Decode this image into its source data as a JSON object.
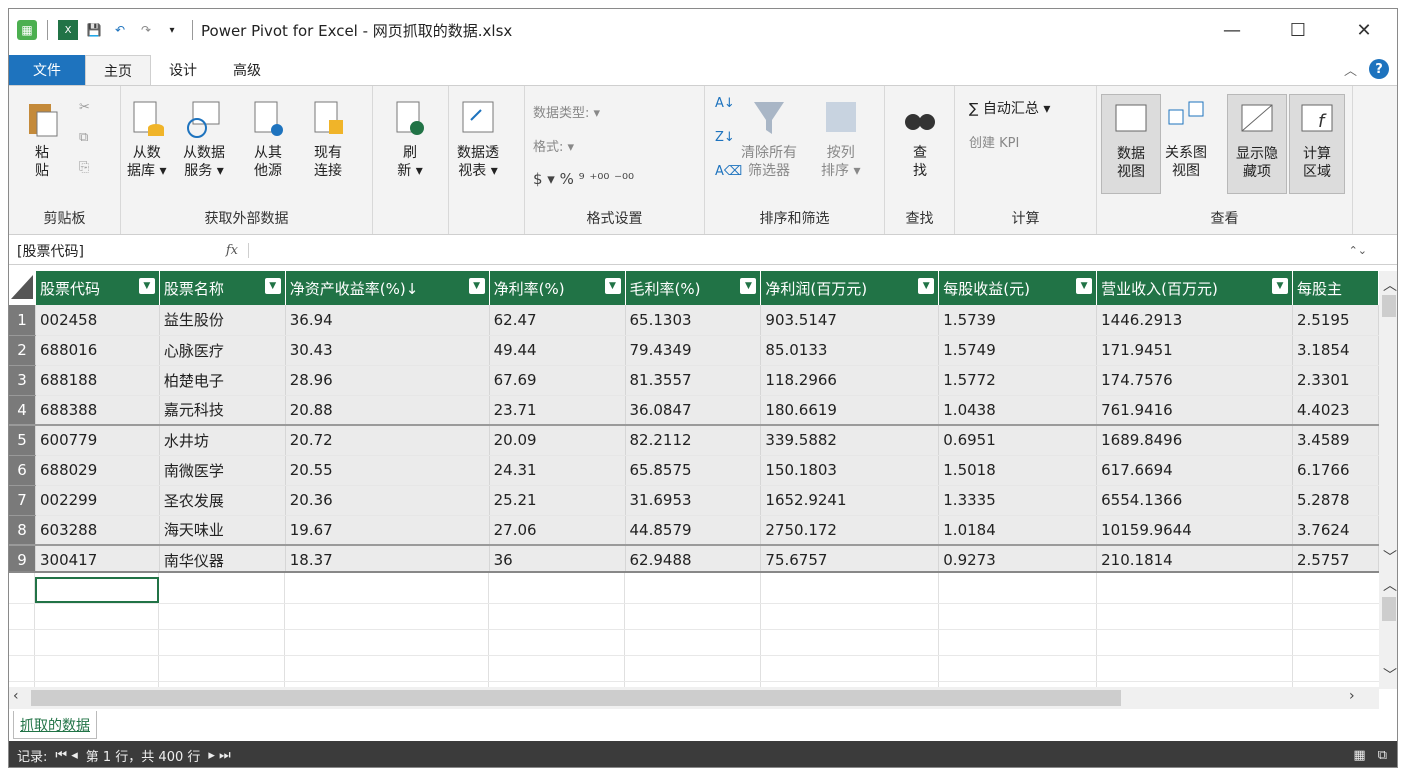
{
  "window": {
    "title": "Power Pivot for Excel - 网页抓取的数据.xlsx"
  },
  "window_controls": {
    "minimize": "—",
    "maximize": "☐",
    "close": "✕"
  },
  "tabs": [
    {
      "label": "文件"
    },
    {
      "label": "主页"
    },
    {
      "label": "设计"
    },
    {
      "label": "高级"
    }
  ],
  "ribbon": {
    "paste": "粘\n贴",
    "groups": {
      "clipboard": "剪贴板",
      "external": "获取外部数据",
      "format": "格式设置",
      "sort": "排序和筛选",
      "find": "查找",
      "calc": "计算",
      "view": "查看"
    },
    "from_db": "从数\n据库 ▾",
    "from_service": "从数据\n服务 ▾",
    "from_other": "从其\n他源",
    "existing": "现有\n连接",
    "refresh": "刷\n新 ▾",
    "pivot": "数据透\n视表 ▾",
    "datatype": "数据类型: ▾",
    "format": "格式: ▾",
    "currency_row": "$ ▾ % ⁹ ⁺⁰⁰ ⁻⁰⁰",
    "clear_filters": "清除所有\n筛选器",
    "sort_by_col": "按列\n排序 ▾",
    "find": "查\n找",
    "autosum": "∑ 自动汇总 ▾",
    "kpi": "创建 KPI",
    "data_view": "数据\n视图",
    "diagram_view": "关系图\n视图",
    "show_hidden": "显示隐\n藏项",
    "calc_area": "计算\n区域"
  },
  "formula_bar": {
    "name_box": "[股票代码]",
    "fx": "fx"
  },
  "table": {
    "columns": [
      "股票代码",
      "股票名称",
      "净资产收益率(%)↓",
      "净利率(%)",
      "毛利率(%)",
      "净利润(百万元)",
      "每股收益(元)",
      "营业收入(百万元)",
      "每股主"
    ],
    "rows": [
      [
        "1",
        "002458",
        "益生股份",
        "36.94",
        "62.47",
        "65.1303",
        "903.5147",
        "1.5739",
        "1446.2913",
        "2.5195"
      ],
      [
        "2",
        "688016",
        "心脉医疗",
        "30.43",
        "49.44",
        "79.4349",
        "85.0133",
        "1.5749",
        "171.9451",
        "3.1854"
      ],
      [
        "3",
        "688188",
        "柏楚电子",
        "28.96",
        "67.69",
        "81.3557",
        "118.2966",
        "1.5772",
        "174.7576",
        "2.3301"
      ],
      [
        "4",
        "688388",
        "嘉元科技",
        "20.88",
        "23.71",
        "36.0847",
        "180.6619",
        "1.0438",
        "761.9416",
        "4.4023"
      ],
      [
        "5",
        "600779",
        "水井坊",
        "20.72",
        "20.09",
        "82.2112",
        "339.5882",
        "0.6951",
        "1689.8496",
        "3.4589"
      ],
      [
        "6",
        "688029",
        "南微医学",
        "20.55",
        "24.31",
        "65.8575",
        "150.1803",
        "1.5018",
        "617.6694",
        "6.1766"
      ],
      [
        "7",
        "002299",
        "圣农发展",
        "20.36",
        "25.21",
        "31.6953",
        "1652.9241",
        "1.3335",
        "6554.1366",
        "5.2878"
      ],
      [
        "8",
        "603288",
        "海天味业",
        "19.67",
        "27.06",
        "44.8579",
        "2750.172",
        "1.0184",
        "10159.9644",
        "3.7624"
      ],
      [
        "9",
        "300417",
        "南华仪器",
        "18.37",
        "36",
        "62.9488",
        "75.6757",
        "0.9273",
        "210.1814",
        "2.5757"
      ]
    ]
  },
  "sheet_tab": "抓取的数据",
  "status": {
    "record_label": "记录:",
    "nav_first": "⏮ ◂",
    "position": "第 1 行，共 400 行",
    "nav_last": "▸ ⏭"
  }
}
